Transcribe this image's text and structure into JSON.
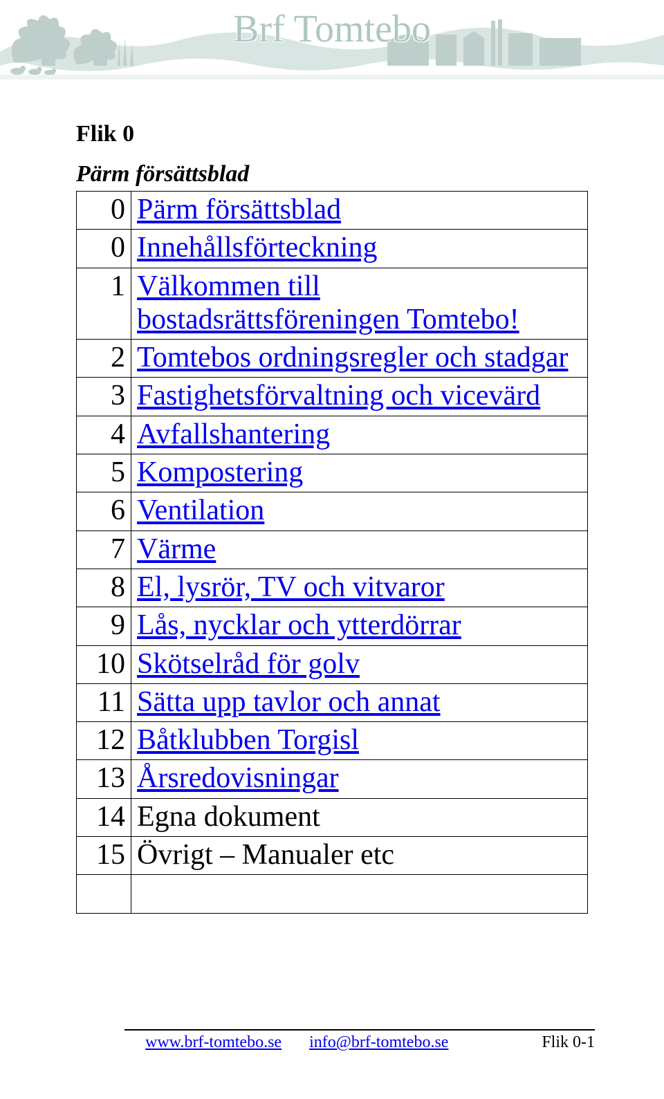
{
  "banner": {
    "title": "Brf Tomtebo"
  },
  "heading": "Flik 0",
  "subheading": "Pärm försättsblad",
  "toc": [
    {
      "num": "0",
      "label": "Pärm försättsblad",
      "link": true
    },
    {
      "num": "0",
      "label": "Innehållsförteckning",
      "link": true
    },
    {
      "num": "1",
      "label": "Välkommen till bostadsrättsföreningen Tomtebo!",
      "link": true
    },
    {
      "num": "2",
      "label": "Tomtebos ordningsregler och stadgar",
      "link": true
    },
    {
      "num": "3",
      "label": "Fastighetsförvaltning och vicevärd",
      "link": true
    },
    {
      "num": "4",
      "label": "Avfallshantering",
      "link": true
    },
    {
      "num": "5",
      "label": "Kompostering",
      "link": true
    },
    {
      "num": "6",
      "label": "Ventilation",
      "link": true
    },
    {
      "num": "7",
      "label": "Värme",
      "link": true
    },
    {
      "num": "8",
      "label": "El, lysrör, TV och vitvaror",
      "link": true
    },
    {
      "num": "9",
      "label": "Lås, nycklar och ytterdörrar",
      "link": true
    },
    {
      "num": "10",
      "label": "Skötselråd för golv",
      "link": true
    },
    {
      "num": "11",
      "label": "Sätta upp tavlor och annat",
      "link": true
    },
    {
      "num": "12",
      "label": "Båtklubben Torgisl",
      "link": true
    },
    {
      "num": "13",
      "label": "Årsredovisningar",
      "link": true
    },
    {
      "num": "14",
      "label": "Egna dokument",
      "link": false
    },
    {
      "num": "15",
      "label": "Övrigt – Manualer etc",
      "link": false
    }
  ],
  "footer": {
    "site": "www.brf-tomtebo.se",
    "email": "info@brf-tomtebo.se",
    "page": "Flik 0-1"
  }
}
